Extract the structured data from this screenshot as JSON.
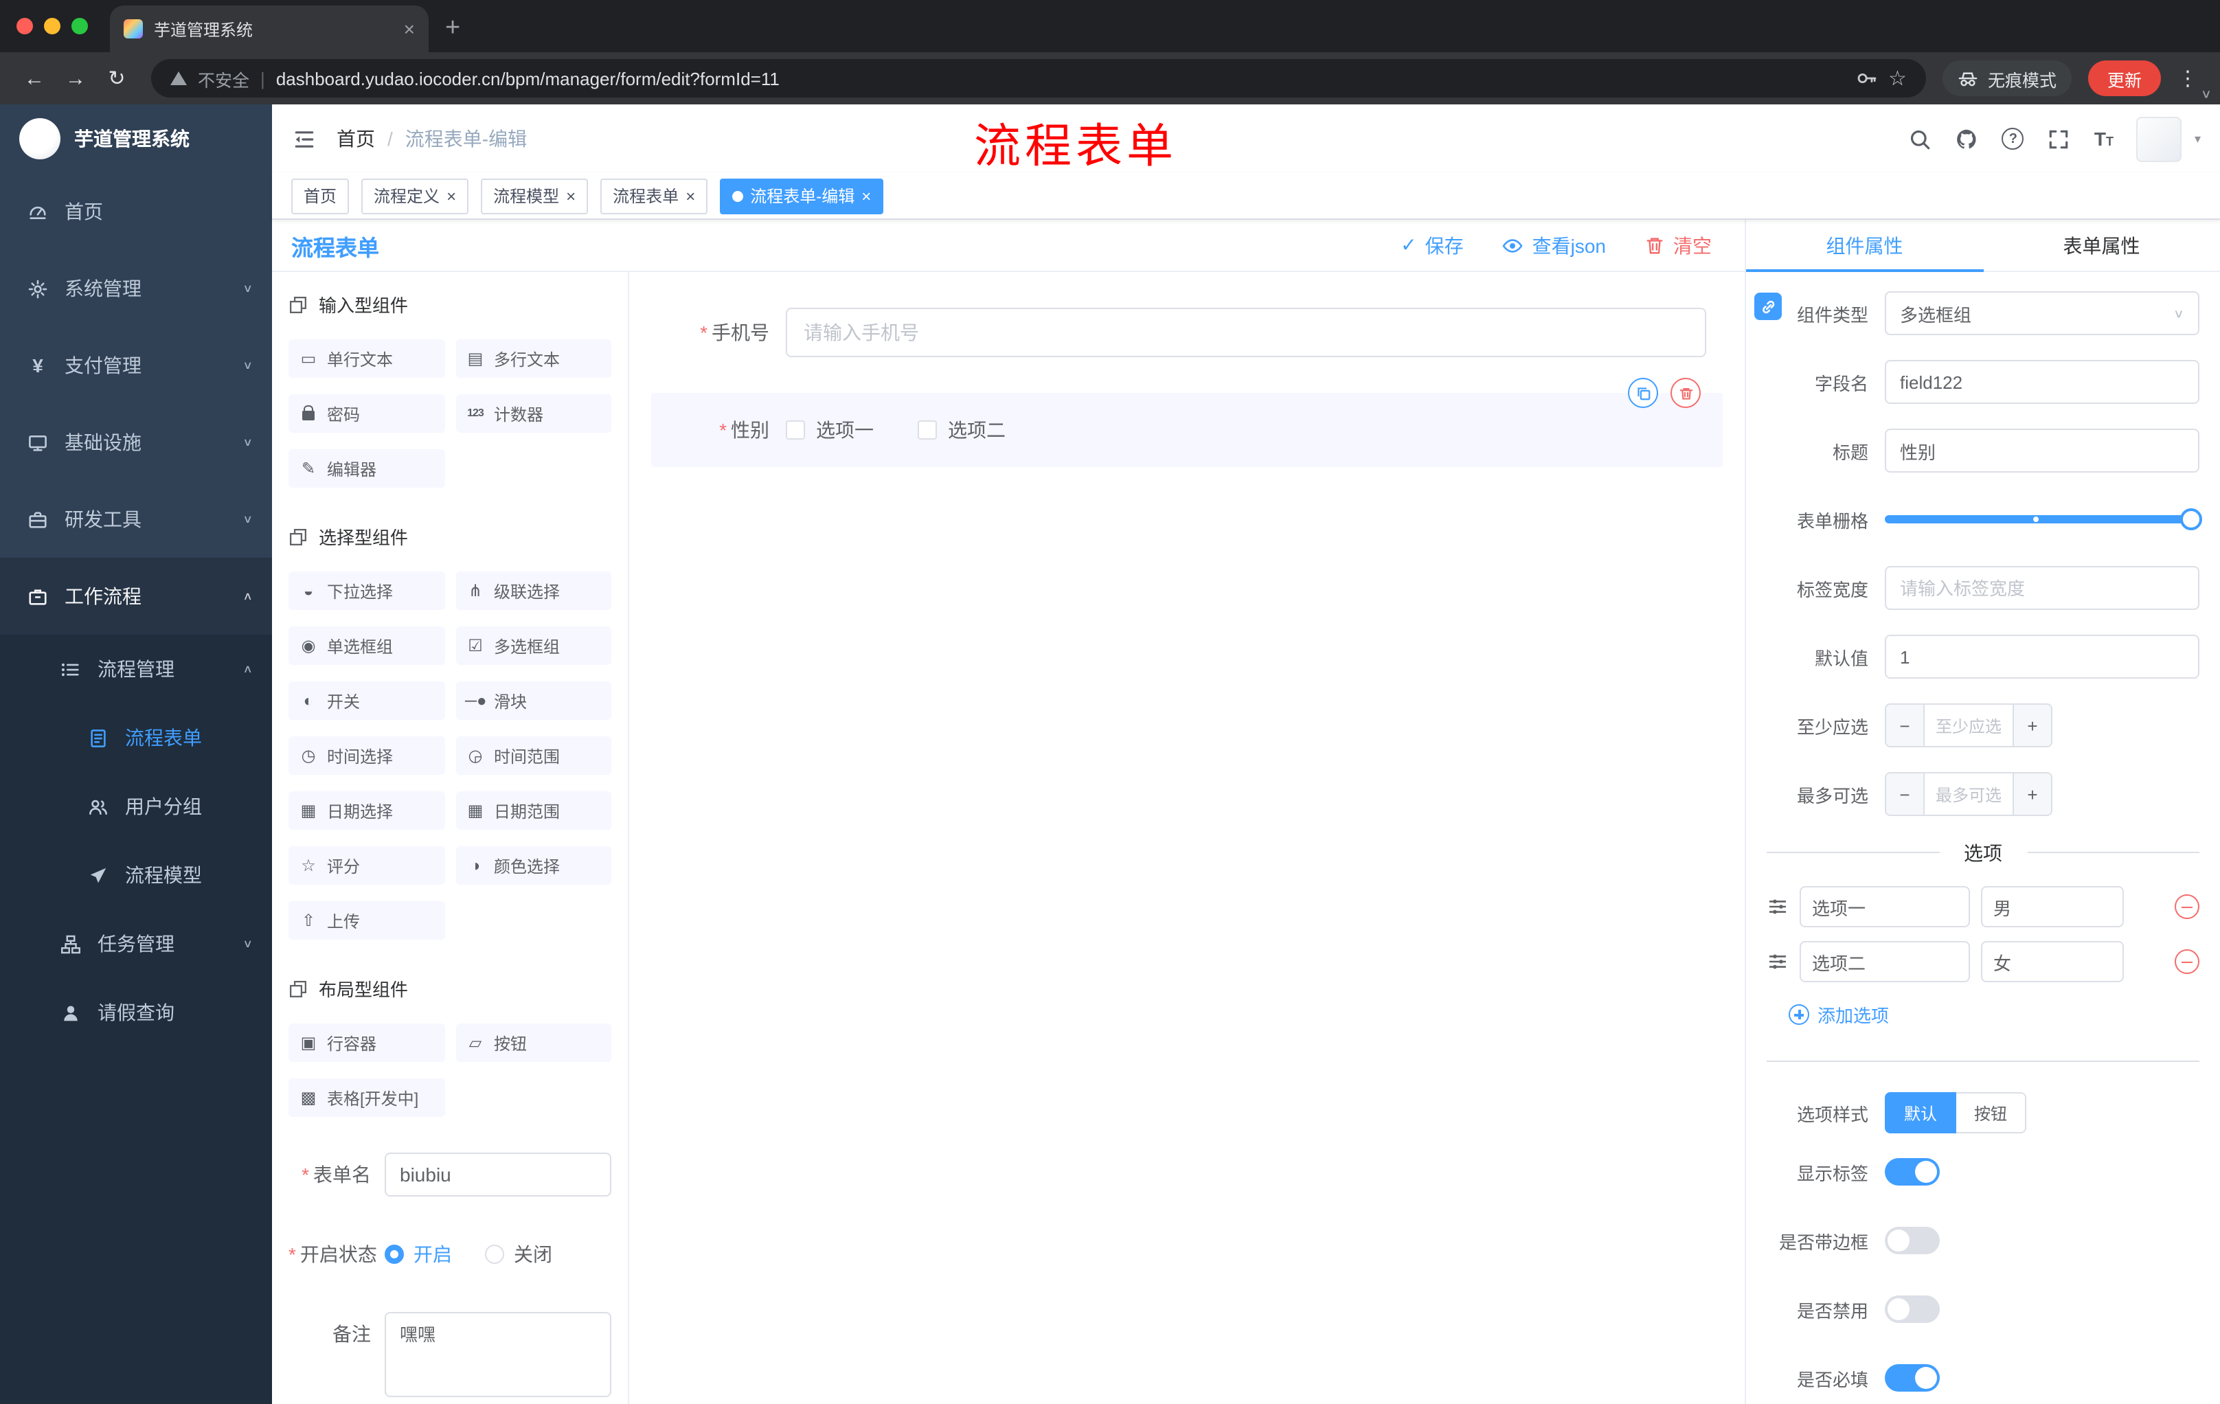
{
  "colors": {
    "accent": "#409eff",
    "danger": "#f56c6c",
    "annotation_red": "#ff0000",
    "sidebar_bg": "#304156",
    "submenu_bg": "#1f2d3d",
    "update_button": "#e8453c"
  },
  "icons": {
    "close": "×",
    "plus": "+",
    "minus": "−",
    "kebab": "⋮",
    "chevron_down": "∨",
    "chevron_up": "∧",
    "caret_down": "▾",
    "back": "←",
    "forward": "→",
    "reload": "↻",
    "check": "✓",
    "question": "?",
    "star": "☆",
    "font_big": "T",
    "font_small": "T",
    "url_separator": "|",
    "required_mark": "*",
    "breadcrumb_separator": "/"
  },
  "browser": {
    "tab_title": "芋道管理系统",
    "security_label": "不安全",
    "url": "dashboard.yudao.iocoder.cn/bpm/manager/form/edit?formId=11",
    "incognito_label": "无痕模式",
    "update_label": "更新"
  },
  "sidebar": {
    "logo_title": "芋道管理系统",
    "items": [
      {
        "label": "首页"
      },
      {
        "label": "系统管理"
      },
      {
        "label": "支付管理"
      },
      {
        "label": "基础设施"
      },
      {
        "label": "研发工具"
      },
      {
        "label": "工作流程"
      },
      {
        "label": "流程管理"
      },
      {
        "label": "流程表单"
      },
      {
        "label": "用户分组"
      },
      {
        "label": "流程模型"
      },
      {
        "label": "任务管理"
      },
      {
        "label": "请假查询"
      }
    ]
  },
  "header": {
    "breadcrumb": [
      "首页",
      "流程表单-编辑"
    ],
    "annotation": "流程表单"
  },
  "tags": [
    {
      "label": "首页"
    },
    {
      "label": "流程定义"
    },
    {
      "label": "流程模型"
    },
    {
      "label": "流程表单"
    },
    {
      "label": "流程表单-编辑"
    }
  ],
  "editor": {
    "title": "流程表单",
    "toolbar": {
      "save": "保存",
      "view_json": "查看json",
      "clear": "清空"
    },
    "palette": {
      "sections": [
        {
          "title": "输入型组件",
          "items": [
            {
              "label": "单行文本",
              "glyph": "▭"
            },
            {
              "label": "多行文本",
              "glyph": "▤"
            },
            {
              "label": "密码",
              "glyph": ""
            },
            {
              "label": "计数器",
              "glyph": "123"
            },
            {
              "label": "编辑器",
              "glyph": "✎"
            }
          ]
        },
        {
          "title": "选择型组件",
          "items": [
            {
              "label": "下拉选择",
              "glyph": "◒"
            },
            {
              "label": "级联选择",
              "glyph": "⋔"
            },
            {
              "label": "单选框组",
              "glyph": "◉"
            },
            {
              "label": "多选框组",
              "glyph": "☑"
            },
            {
              "label": "开关",
              "glyph": "◐"
            },
            {
              "label": "滑块",
              "glyph": "─●"
            },
            {
              "label": "时间选择",
              "glyph": "◷"
            },
            {
              "label": "时间范围",
              "glyph": "◶"
            },
            {
              "label": "日期选择",
              "glyph": "▦"
            },
            {
              "label": "日期范围",
              "glyph": "▦"
            },
            {
              "label": "评分",
              "glyph": "☆"
            },
            {
              "label": "颜色选择",
              "glyph": "◑"
            },
            {
              "label": "上传",
              "glyph": "⇧"
            }
          ]
        },
        {
          "title": "布局型组件",
          "items": [
            {
              "label": "行容器",
              "glyph": "▣"
            },
            {
              "label": "按钮",
              "glyph": "▱"
            },
            {
              "label": "表格[开发中]",
              "glyph": "▩"
            }
          ]
        }
      ]
    },
    "form_config": {
      "name_label": "表单名",
      "name_value": "biubiu",
      "status_label": "开启状态",
      "status_on": "开启",
      "status_off": "关闭",
      "remark_label": "备注",
      "remark_value": "嘿嘿"
    },
    "canvas": {
      "phone": {
        "label": "手机号",
        "placeholder": "请输入手机号"
      },
      "gender": {
        "label": "性别",
        "option1": "选项一",
        "option2": "选项二"
      }
    },
    "properties": {
      "tab_component": "组件属性",
      "tab_form": "表单属性",
      "component_type_label": "组件类型",
      "component_type_value": "多选框组",
      "field_name_label": "字段名",
      "field_name_value": "field122",
      "title_label": "标题",
      "title_value": "性别",
      "grid_label": "表单栅格",
      "label_width_label": "标签宽度",
      "label_width_placeholder": "请输入标签宽度",
      "default_label": "默认值",
      "default_value": "1",
      "min_label": "至少应选",
      "min_placeholder": "至少应选",
      "max_label": "最多可选",
      "max_placeholder": "最多可选",
      "options_title": "选项",
      "options": [
        {
          "name": "选项一",
          "value": "男"
        },
        {
          "name": "选项二",
          "value": "女"
        }
      ],
      "add_option": "添加选项",
      "style_label": "选项样式",
      "style_default": "默认",
      "style_button": "按钮",
      "switch_show_label": "显示标签",
      "switch_border": "是否带边框",
      "switch_disabled": "是否禁用",
      "switch_required": "是否必填"
    }
  }
}
